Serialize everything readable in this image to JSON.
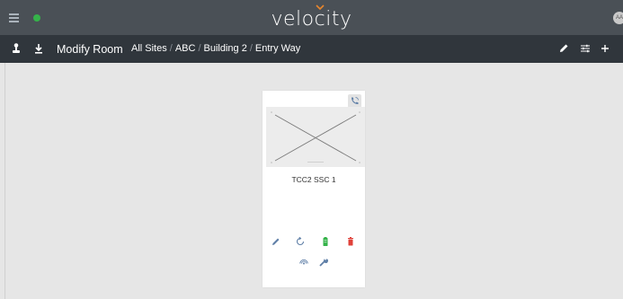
{
  "app": {
    "logo_text": "velocity",
    "user_initials": "AA",
    "status_color": "#35b34a"
  },
  "toolbar": {
    "title": "Modify Room",
    "breadcrumbs": [
      "All Sites",
      "ABC",
      "Building 2",
      "Entry Way"
    ],
    "separator": "/",
    "left_icons": [
      "joystick-icon",
      "download-icon"
    ],
    "right_icons": [
      "pencil-icon",
      "sliders-icon",
      "plus-icon"
    ]
  },
  "device_card": {
    "name": "TCC2 SSC 1",
    "phone_icon": "phone-icon",
    "actions_row1": [
      "edit-icon",
      "sync-icon",
      "battery-icon",
      "delete-icon"
    ],
    "actions_row2": [
      "wireless-icon",
      "wrench-icon"
    ],
    "colors": {
      "edit": "#5f7fa7",
      "sync": "#5f7fa7",
      "battery": "#35b34a",
      "delete": "#e0413a",
      "wireless": "#5f7fa7",
      "wrench": "#5f7fa7"
    }
  }
}
